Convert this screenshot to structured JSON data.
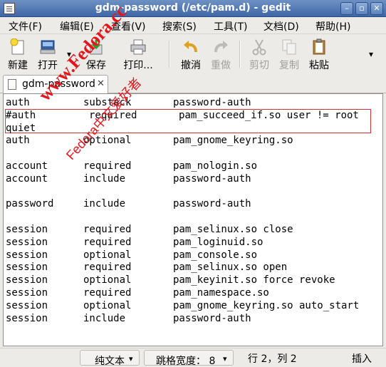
{
  "window": {
    "title": "gdm-password (/etc/pam.d) - gedit"
  },
  "controls": {
    "minimize": "–",
    "maximize": "▫",
    "close": "✕"
  },
  "menu": [
    "文件(F)",
    "编辑(E)",
    "查看(V)",
    "搜索(S)",
    "工具(T)",
    "文档(D)",
    "帮助(H)"
  ],
  "toolbar": {
    "new": "新建",
    "open": "打开",
    "open_arrow": "▾",
    "save": "保存",
    "print": "打印...",
    "undo": "撤消",
    "redo": "重做",
    "cut": "剪切",
    "copy": "复制",
    "paste": "粘贴",
    "overflow": "▾"
  },
  "tab": {
    "label": "gdm-password",
    "close": "✕"
  },
  "editor": {
    "lines": [
      [
        "auth",
        "substack",
        "password-auth"
      ],
      [
        "#auth",
        "required",
        "pam_succeed_if.so user != root"
      ],
      [
        "quiet",
        "",
        ""
      ],
      [
        "auth",
        "optional",
        "pam_gnome_keyring.so"
      ],
      [
        "",
        "",
        ""
      ],
      [
        "account",
        "required",
        "pam_nologin.so"
      ],
      [
        "account",
        "include",
        "password-auth"
      ],
      [
        "",
        "",
        ""
      ],
      [
        "password",
        "include",
        "password-auth"
      ],
      [
        "",
        "",
        ""
      ],
      [
        "session",
        "required",
        "pam_selinux.so close"
      ],
      [
        "session",
        "required",
        "pam_loginuid.so"
      ],
      [
        "session",
        "optional",
        "pam_console.so"
      ],
      [
        "session",
        "required",
        "pam_selinux.so open"
      ],
      [
        "session",
        "optional",
        "pam_keyinit.so force revoke"
      ],
      [
        "session",
        "required",
        "pam_namespace.so"
      ],
      [
        "session",
        "optional",
        "pam_gnome_keyring.so auto_start"
      ],
      [
        "session",
        "include",
        "password-auth"
      ]
    ]
  },
  "watermark": {
    "line1": "www.Fedora.cc",
    "line2": "Fedora中文爱好者"
  },
  "status": {
    "language": "纯文本",
    "tab_width": "跳格宽度： 8",
    "position": "行 2，列 2",
    "mode": "插入",
    "arrow": "▾"
  }
}
